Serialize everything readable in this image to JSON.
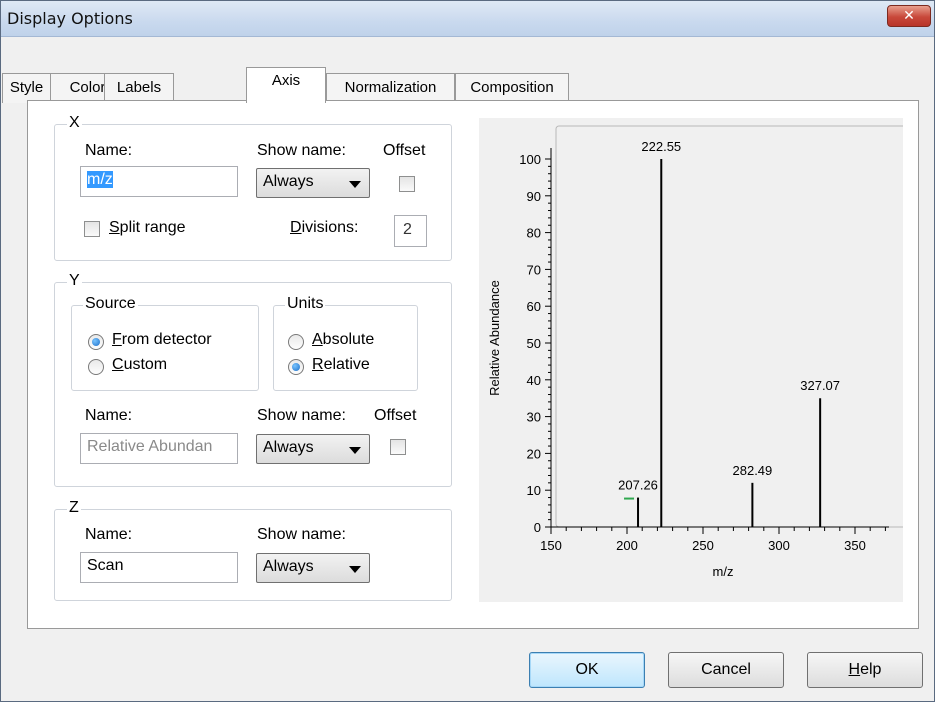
{
  "window": {
    "title": "Display Options",
    "close_glyph": "✕"
  },
  "tabs": [
    {
      "label": "Style"
    },
    {
      "label": "Color"
    },
    {
      "label": "Labels"
    },
    {
      "label": "Axis",
      "active": true
    },
    {
      "label": "Normalization"
    },
    {
      "label": "Composition"
    }
  ],
  "x_group": {
    "legend": "X",
    "name_label": "Name:",
    "name_value": "m/z",
    "show_name_label": "Show name:",
    "show_name_value": "Always",
    "offset_label": "Offset",
    "offset_checked": false,
    "split_range_label_u": "S",
    "split_range_label_rest": "plit range",
    "split_range_checked": false,
    "divisions_label_u": "D",
    "divisions_label_rest": "ivisions:",
    "divisions_value": "2"
  },
  "y_group": {
    "legend": "Y",
    "source_legend": "Source",
    "source_from_detector_u": "F",
    "source_from_detector_rest": "rom detector",
    "source_custom_u": "C",
    "source_custom_rest": "ustom",
    "source_selected": "From detector",
    "units_legend": "Units",
    "units_absolute_u": "A",
    "units_absolute_rest": "bsolute",
    "units_relative_u": "R",
    "units_relative_rest": "elative",
    "units_selected": "Relative",
    "name_label": "Name:",
    "name_value": "Relative Abundan",
    "show_name_label": "Show name:",
    "show_name_value": "Always",
    "offset_label": "Offset",
    "offset_checked": false
  },
  "z_group": {
    "legend": "Z",
    "name_label": "Name:",
    "name_value": "Scan",
    "show_name_label": "Show name:",
    "show_name_value": "Always"
  },
  "buttons": {
    "ok": "OK",
    "cancel": "Cancel",
    "help_u": "H",
    "help_rest": "elp"
  },
  "chart_data": {
    "type": "bar",
    "xlabel": "m/z",
    "ylabel": "Relative Abundance",
    "xlim": [
      150,
      375
    ],
    "ylim": [
      0,
      100
    ],
    "x_ticks": [
      150,
      200,
      250,
      300,
      350
    ],
    "y_ticks": [
      0,
      10,
      20,
      30,
      40,
      50,
      60,
      70,
      80,
      90,
      100
    ],
    "peaks": [
      {
        "x": 207.26,
        "y": 8,
        "label": "207.26"
      },
      {
        "x": 222.55,
        "y": 100,
        "label": "222.55"
      },
      {
        "x": 282.49,
        "y": 12,
        "label": "282.49"
      },
      {
        "x": 327.07,
        "y": 35,
        "label": "327.07"
      }
    ],
    "colors": {
      "peak": "#000000",
      "plot_bg": "#f0f0f0",
      "marker": "#2fa84f"
    }
  }
}
